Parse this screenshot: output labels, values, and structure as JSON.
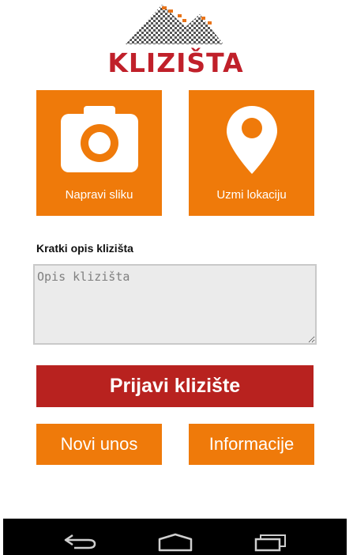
{
  "brand": {
    "logo_text": "KLIZIŠTA",
    "accent": "#c0202a",
    "orange": "#ef7a0a"
  },
  "tiles": {
    "photo": {
      "label": "Napravi sliku",
      "icon": "camera-icon"
    },
    "location": {
      "label": "Uzmi lokaciju",
      "icon": "location-pin-icon"
    }
  },
  "description": {
    "label": "Kratki opis klizišta",
    "placeholder": "Opis klizišta",
    "value": ""
  },
  "buttons": {
    "report": "Prijavi klizište",
    "new_entry": "Novi unos",
    "info": "Informacije"
  },
  "navbar": {
    "icons": [
      "back-icon",
      "home-icon",
      "recent-apps-icon"
    ]
  }
}
